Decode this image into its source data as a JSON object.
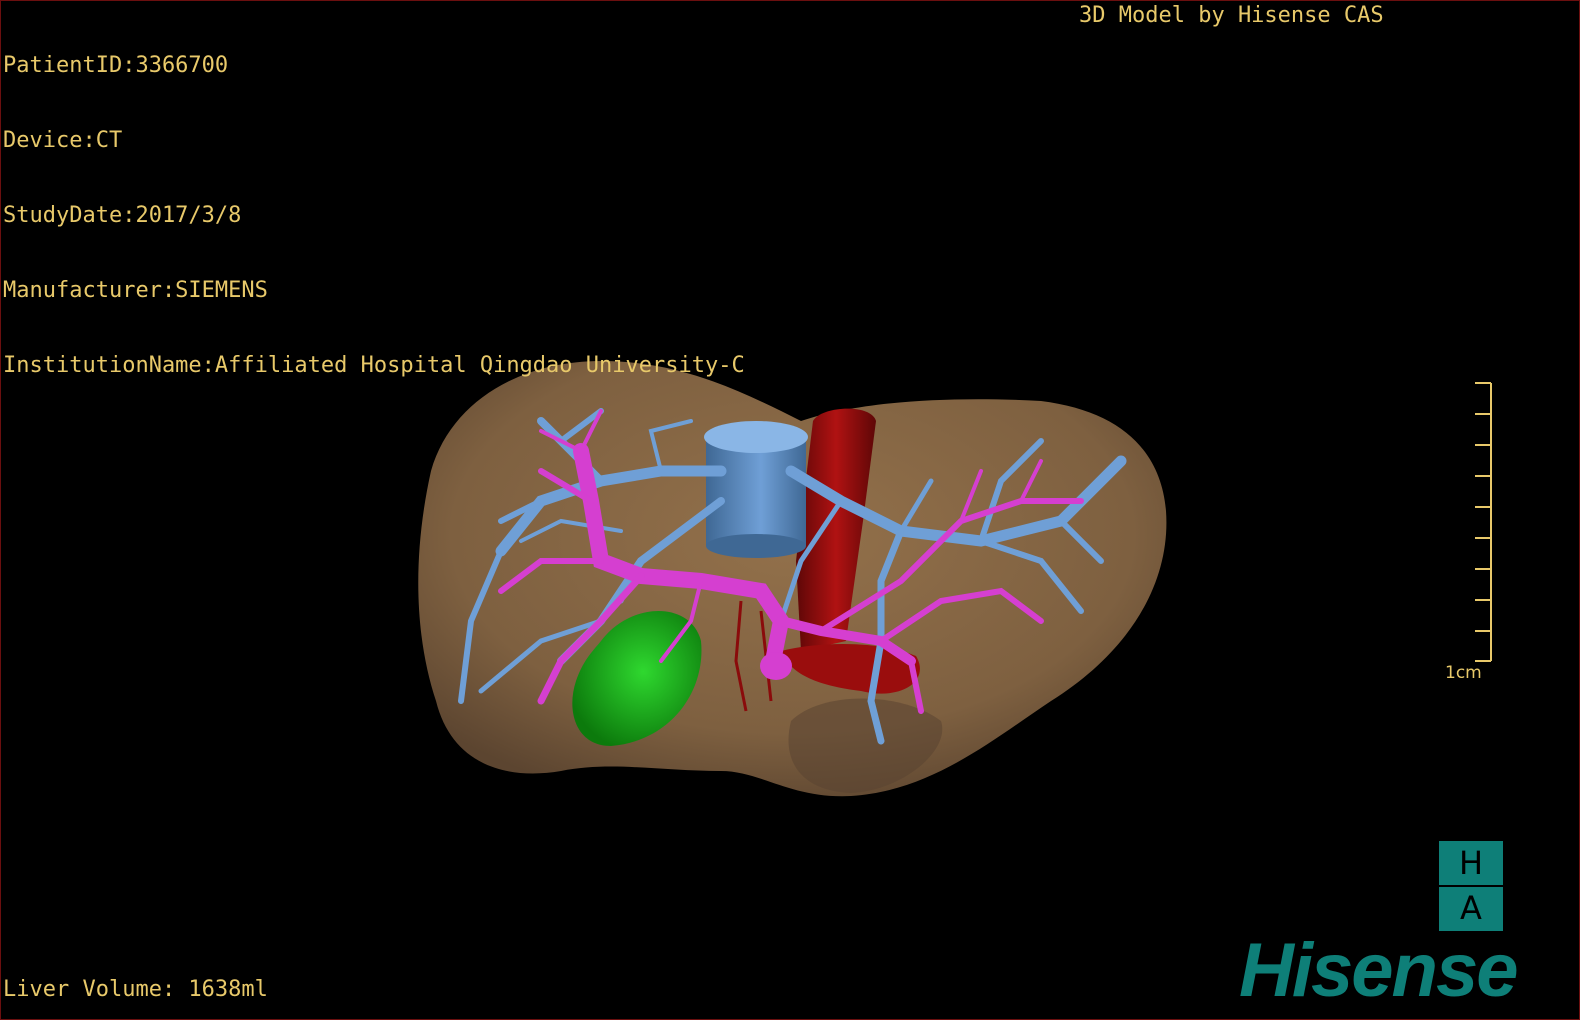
{
  "viewer": {
    "patient_id": "PatientID:3366700",
    "device": "Device:CT",
    "study_date": "StudyDate:2017/3/8",
    "manufacturer": "Manufacturer:SIEMENS",
    "institution": "InstitutionName:Affiliated Hospital Qingdao University-C",
    "model_credit": "3D Model by Hisense CAS",
    "liver_volume": "Liver Volume: 1638ml"
  },
  "scale_bar": {
    "label": "1cm"
  },
  "brand": {
    "logo_letters": [
      "H",
      "A"
    ],
    "wordmark": "Hisense"
  },
  "colors": {
    "background": "#000000",
    "overlay_text": "#e8c96a",
    "liver": "#8a6a45",
    "hepatic_veins": "#6f9fd6",
    "portal_vein": "#d53fd0",
    "ivc_aorta": "#9a0d0d",
    "gallbladder": "#16a81a",
    "brand": "#0e7f78"
  },
  "icons": [
    "liver-3d-model",
    "scale-bar",
    "ha-logo-icon"
  ]
}
